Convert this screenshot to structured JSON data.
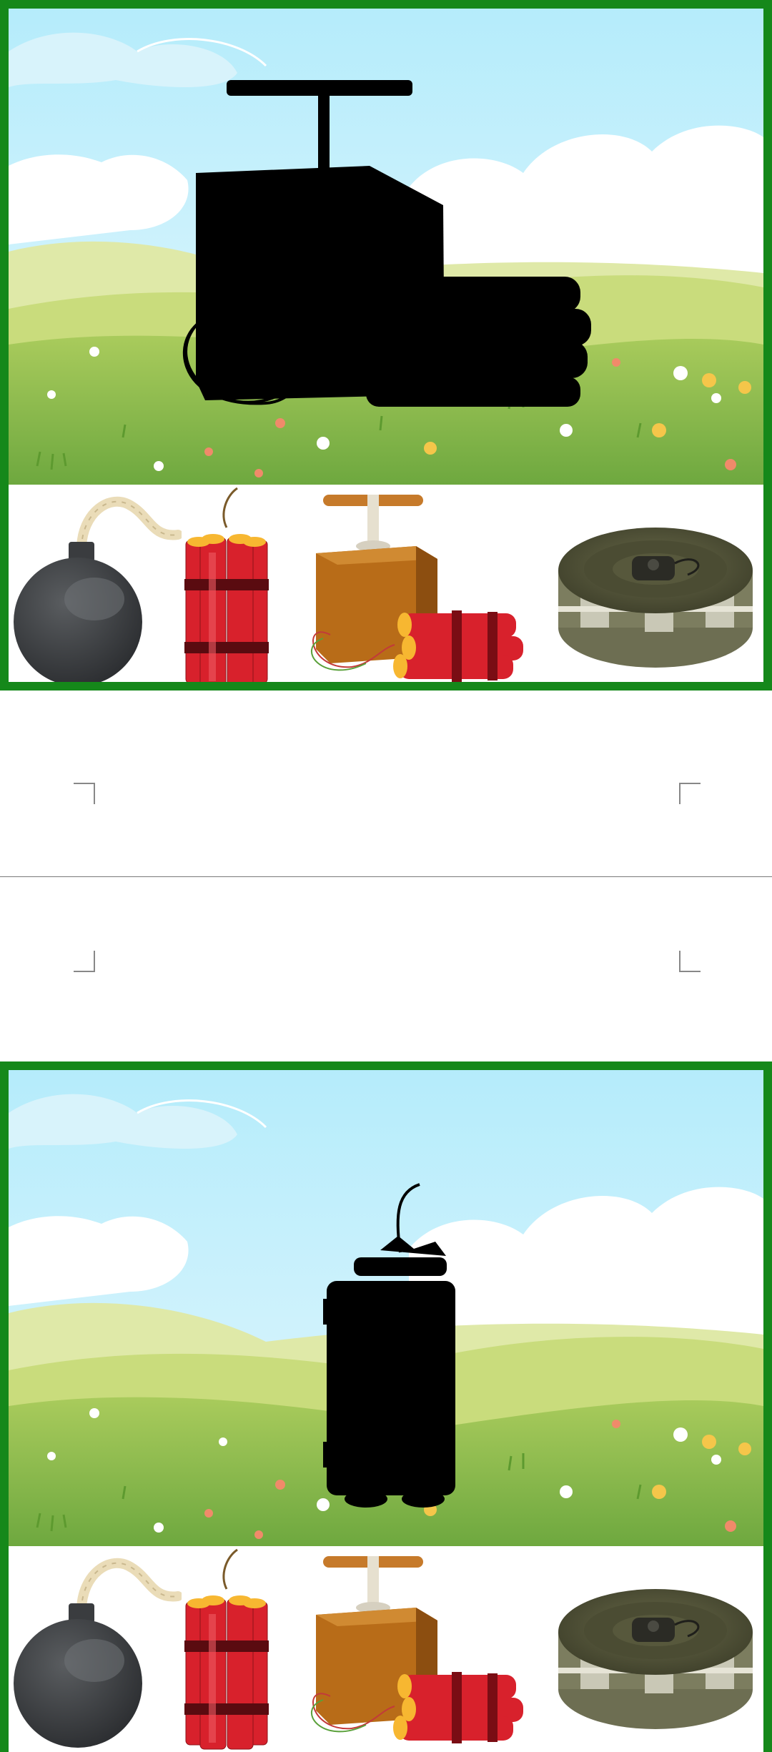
{
  "puzzles": [
    {
      "id_label": "puzzle-1",
      "silhouette": "detonator-box-with-dynamite",
      "options": [
        "bomb",
        "dynamite-bundle",
        "detonator-box-with-dynamite",
        "landmine"
      ]
    },
    {
      "id_label": "puzzle-2",
      "silhouette": "dynamite-bundle",
      "options": [
        "bomb",
        "dynamite-bundle",
        "detonator-box-with-dynamite",
        "landmine"
      ]
    }
  ],
  "colors": {
    "frame": "#15881a",
    "sky": "#bfeefb",
    "grass": "#8bbd4e"
  }
}
